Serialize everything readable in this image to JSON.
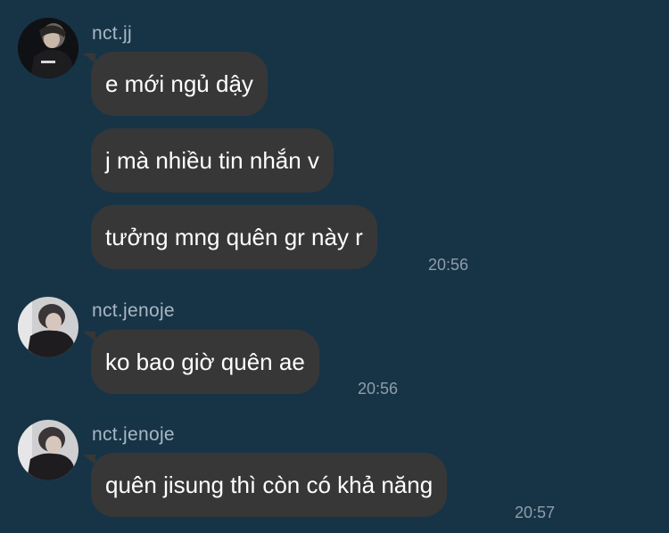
{
  "messages": [
    {
      "sender": "nct.jj",
      "avatar_icon": "user-avatar-icon",
      "texts": [
        "e mới ngủ dậy",
        "j mà nhiều tin nhắn v",
        "tưởng mng quên gr này r"
      ],
      "time": "20:56"
    },
    {
      "sender": "nct.jenoje",
      "avatar_icon": "user-avatar-icon",
      "texts": [
        "ko bao giờ quên ae"
      ],
      "time": "20:56"
    },
    {
      "sender": "nct.jenoje",
      "avatar_icon": "user-avatar-icon",
      "texts": [
        "quên jisung thì còn có khả năng"
      ],
      "time": "20:57"
    }
  ],
  "colors": {
    "background": "#173447",
    "bubble": "#373738",
    "message_text": "#ffffff",
    "sender_name": "#a9b7c2",
    "timestamp": "#8f9da8"
  }
}
